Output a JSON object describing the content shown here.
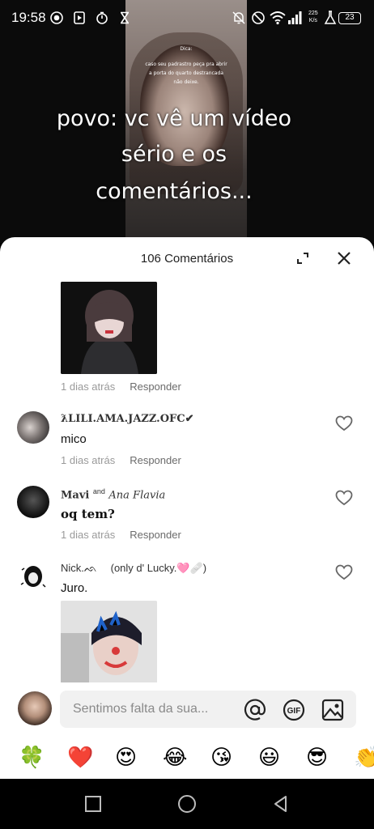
{
  "status_bar": {
    "time": "19:58",
    "net_speed_top": "225",
    "net_speed_bottom": "K/s",
    "battery": "23"
  },
  "video": {
    "small_caption_1": "Dica:",
    "small_caption_2": "caso seu padrastro peça pra abrir",
    "small_caption_3": "a porta do quarto destrancada",
    "small_caption_4": "não deixe.",
    "overlay_line_1": "povo: vc vê um vídeo",
    "overlay_line_2": "sério e os",
    "overlay_line_3": "comentários..."
  },
  "comments_sheet": {
    "title": "106 Comentários",
    "comments": [
      {
        "user": "",
        "text": "",
        "time": "1 dias atrás",
        "reply_label": "Responder"
      },
      {
        "user": "ƛLILI.AMA.JAZZ.OFC✔",
        "text": "mico",
        "time": "1 dias atrás",
        "reply_label": "Responder"
      },
      {
        "user_a": "Mavi",
        "user_and": "and",
        "user_b": "Ana Flavia",
        "text": "oq tem?",
        "time": "1 dias atrás",
        "reply_label": "Responder"
      },
      {
        "user": "Nick.ᨒ",
        "user_extra": "(only d' Lucky.🩷🩹)",
        "text": "Juro.",
        "time": "",
        "reply_label": ""
      }
    ]
  },
  "input_bar": {
    "placeholder": "Sentimos falta da sua..."
  },
  "emoji_bar": [
    "🍀",
    "❤️",
    "😍",
    "😂",
    "😘",
    "😃",
    "😎",
    "👏"
  ],
  "colors": {
    "sheet_bg": "#ffffff",
    "heart_outline": "#666666",
    "meta_gray": "#9a9a9a"
  }
}
